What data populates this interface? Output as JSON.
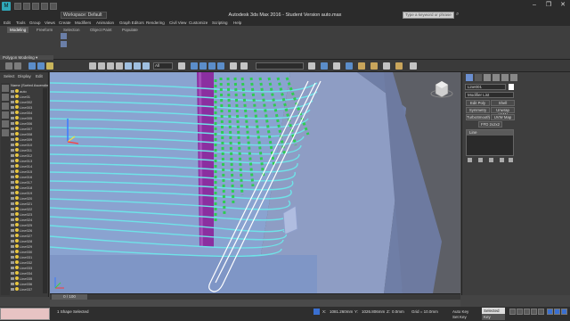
{
  "app": {
    "title": "Autodesk 3ds Max 2016 - Student Version    auto.max",
    "workspace": "Workspace: Default",
    "search_placeholder": "Type a keyword or phrase",
    "window_controls": [
      "–",
      "❐",
      "✕"
    ]
  },
  "menu": [
    "Edit",
    "Tools",
    "Group",
    "Views",
    "Create",
    "Modifiers",
    "Animation",
    "Graph Editors",
    "Rendering",
    "Civil View",
    "Customize",
    "Scripting",
    "Help"
  ],
  "ribbon": {
    "tabs": [
      "Modeling",
      "Freeform",
      "Selection",
      "Object Paint",
      "Populate"
    ],
    "active_tab": "Modeling",
    "panel_label": "Polygon Modeling ▾"
  },
  "toolbar": {
    "selection_filter": "All",
    "undo_icon": "undo-icon",
    "redo_icon": "redo-icon"
  },
  "explorer": {
    "tabs": [
      "Select",
      "Display",
      "Edit"
    ],
    "root": "Name (Sorted Ascending)",
    "items": [
      "auto",
      "Line01",
      "Line002",
      "Line003",
      "Line004",
      "Line005",
      "Line006",
      "Line007",
      "Line008",
      "Line009",
      "Line010",
      "Line011",
      "Line012",
      "Line013",
      "Line014",
      "Line015",
      "Line016",
      "Line017",
      "Line018",
      "Line019",
      "Line020",
      "Line021",
      "Line022",
      "Line023",
      "Line024",
      "Line025",
      "Line026",
      "Line027",
      "Line028",
      "Line029",
      "Line030",
      "Line031",
      "Line032",
      "Line033",
      "Line034",
      "Line035",
      "Line036",
      "Line037"
    ]
  },
  "command_panel": {
    "name_field": "Line001",
    "modifier_list": "Modifier List",
    "buttons": [
      "Edit Poly",
      "Shell",
      "Symmetry",
      "Unwrap UVW",
      "TurboSmooth",
      "UVW Map",
      "FFD 2x2x2"
    ],
    "stack_item": "Line"
  },
  "timeline": {
    "frame_counter": "0 / 100"
  },
  "status": {
    "selection": "1 Shape Selected",
    "x_label": "X:",
    "x_value": "1081.260mm",
    "y_label": "Y:",
    "y_value": "1026.806mm",
    "z_label": "Z:",
    "z_value": "0.0mm",
    "grid": "Grid = 10.0mm",
    "auto_key": "Auto Key",
    "selected": "Selected",
    "set_key": "Set Key",
    "key_filters": "Key Filters..."
  }
}
